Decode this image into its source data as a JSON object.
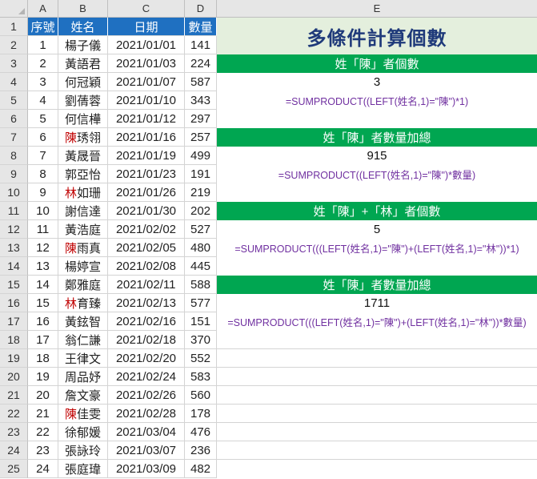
{
  "columns": [
    "A",
    "B",
    "C",
    "D",
    "E"
  ],
  "header_row": {
    "seq": "序號",
    "name": "姓名",
    "date": "日期",
    "qty": "數量"
  },
  "rows": [
    {
      "seq": "1",
      "name_first": "",
      "name_rest": "楊子儀",
      "date": "2021/01/01",
      "qty": "141"
    },
    {
      "seq": "2",
      "name_first": "",
      "name_rest": "黃語君",
      "date": "2021/01/03",
      "qty": "224"
    },
    {
      "seq": "3",
      "name_first": "",
      "name_rest": "何冠穎",
      "date": "2021/01/07",
      "qty": "587"
    },
    {
      "seq": "4",
      "name_first": "",
      "name_rest": "劉蒨蓉",
      "date": "2021/01/10",
      "qty": "343"
    },
    {
      "seq": "5",
      "name_first": "",
      "name_rest": "何信樺",
      "date": "2021/01/12",
      "qty": "297"
    },
    {
      "seq": "6",
      "name_first": "陳",
      "name_rest": "琇翎",
      "date": "2021/01/16",
      "qty": "257"
    },
    {
      "seq": "7",
      "name_first": "",
      "name_rest": "黃晟晉",
      "date": "2021/01/19",
      "qty": "499"
    },
    {
      "seq": "8",
      "name_first": "",
      "name_rest": "郭亞怡",
      "date": "2021/01/23",
      "qty": "191"
    },
    {
      "seq": "9",
      "name_first": "林",
      "name_rest": "如珊",
      "date": "2021/01/26",
      "qty": "219"
    },
    {
      "seq": "10",
      "name_first": "",
      "name_rest": "謝信達",
      "date": "2021/01/30",
      "qty": "202"
    },
    {
      "seq": "11",
      "name_first": "",
      "name_rest": "黃浩庭",
      "date": "2021/02/02",
      "qty": "527"
    },
    {
      "seq": "12",
      "name_first": "陳",
      "name_rest": "雨真",
      "date": "2021/02/05",
      "qty": "480"
    },
    {
      "seq": "13",
      "name_first": "",
      "name_rest": "楊婷宣",
      "date": "2021/02/08",
      "qty": "445"
    },
    {
      "seq": "14",
      "name_first": "",
      "name_rest": "鄭雅庭",
      "date": "2021/02/11",
      "qty": "588"
    },
    {
      "seq": "15",
      "name_first": "林",
      "name_rest": "育臻",
      "date": "2021/02/13",
      "qty": "577"
    },
    {
      "seq": "16",
      "name_first": "",
      "name_rest": "黃鉉智",
      "date": "2021/02/16",
      "qty": "151"
    },
    {
      "seq": "17",
      "name_first": "",
      "name_rest": "翁仁謙",
      "date": "2021/02/18",
      "qty": "370"
    },
    {
      "seq": "18",
      "name_first": "",
      "name_rest": "王律文",
      "date": "2021/02/20",
      "qty": "552"
    },
    {
      "seq": "19",
      "name_first": "",
      "name_rest": "周品妤",
      "date": "2021/02/24",
      "qty": "583"
    },
    {
      "seq": "20",
      "name_first": "",
      "name_rest": "詹文豪",
      "date": "2021/02/26",
      "qty": "560"
    },
    {
      "seq": "21",
      "name_first": "陳",
      "name_rest": "佳雯",
      "date": "2021/02/28",
      "qty": "178"
    },
    {
      "seq": "22",
      "name_first": "",
      "name_rest": "徐郁媛",
      "date": "2021/03/04",
      "qty": "476"
    },
    {
      "seq": "23",
      "name_first": "",
      "name_rest": "張詠玲",
      "date": "2021/03/07",
      "qty": "236"
    },
    {
      "seq": "24",
      "name_first": "",
      "name_rest": "張庭瑋",
      "date": "2021/03/09",
      "qty": "482"
    }
  ],
  "e_column": {
    "title": "多條件計算個數",
    "sections": [
      {
        "header": "姓「陳」者個數",
        "result": "3",
        "formula": "=SUMPRODUCT((LEFT(姓名,1)=\"陳\")*1)"
      },
      {
        "header": "姓「陳」者數量加總",
        "result": "915",
        "formula": "=SUMPRODUCT((LEFT(姓名,1)=\"陳\")*數量)"
      },
      {
        "header": "姓「陳」+「林」者個數",
        "result": "5",
        "formula": "=SUMPRODUCT(((LEFT(姓名,1)=\"陳\")+(LEFT(姓名,1)=\"林\"))*1)"
      },
      {
        "header": "姓「陳」者數量加總",
        "result": "1711",
        "formula": "=SUMPRODUCT(((LEFT(姓名,1)=\"陳\")+(LEFT(姓名,1)=\"林\"))*數量)"
      }
    ]
  },
  "colors": {
    "header_blue": "#1f70c1",
    "section_green": "#00a651",
    "title_bg": "#e4efdd",
    "title_text": "#1f3a7a",
    "formula_purple": "#7030a0",
    "highlight_red": "#c00000"
  }
}
